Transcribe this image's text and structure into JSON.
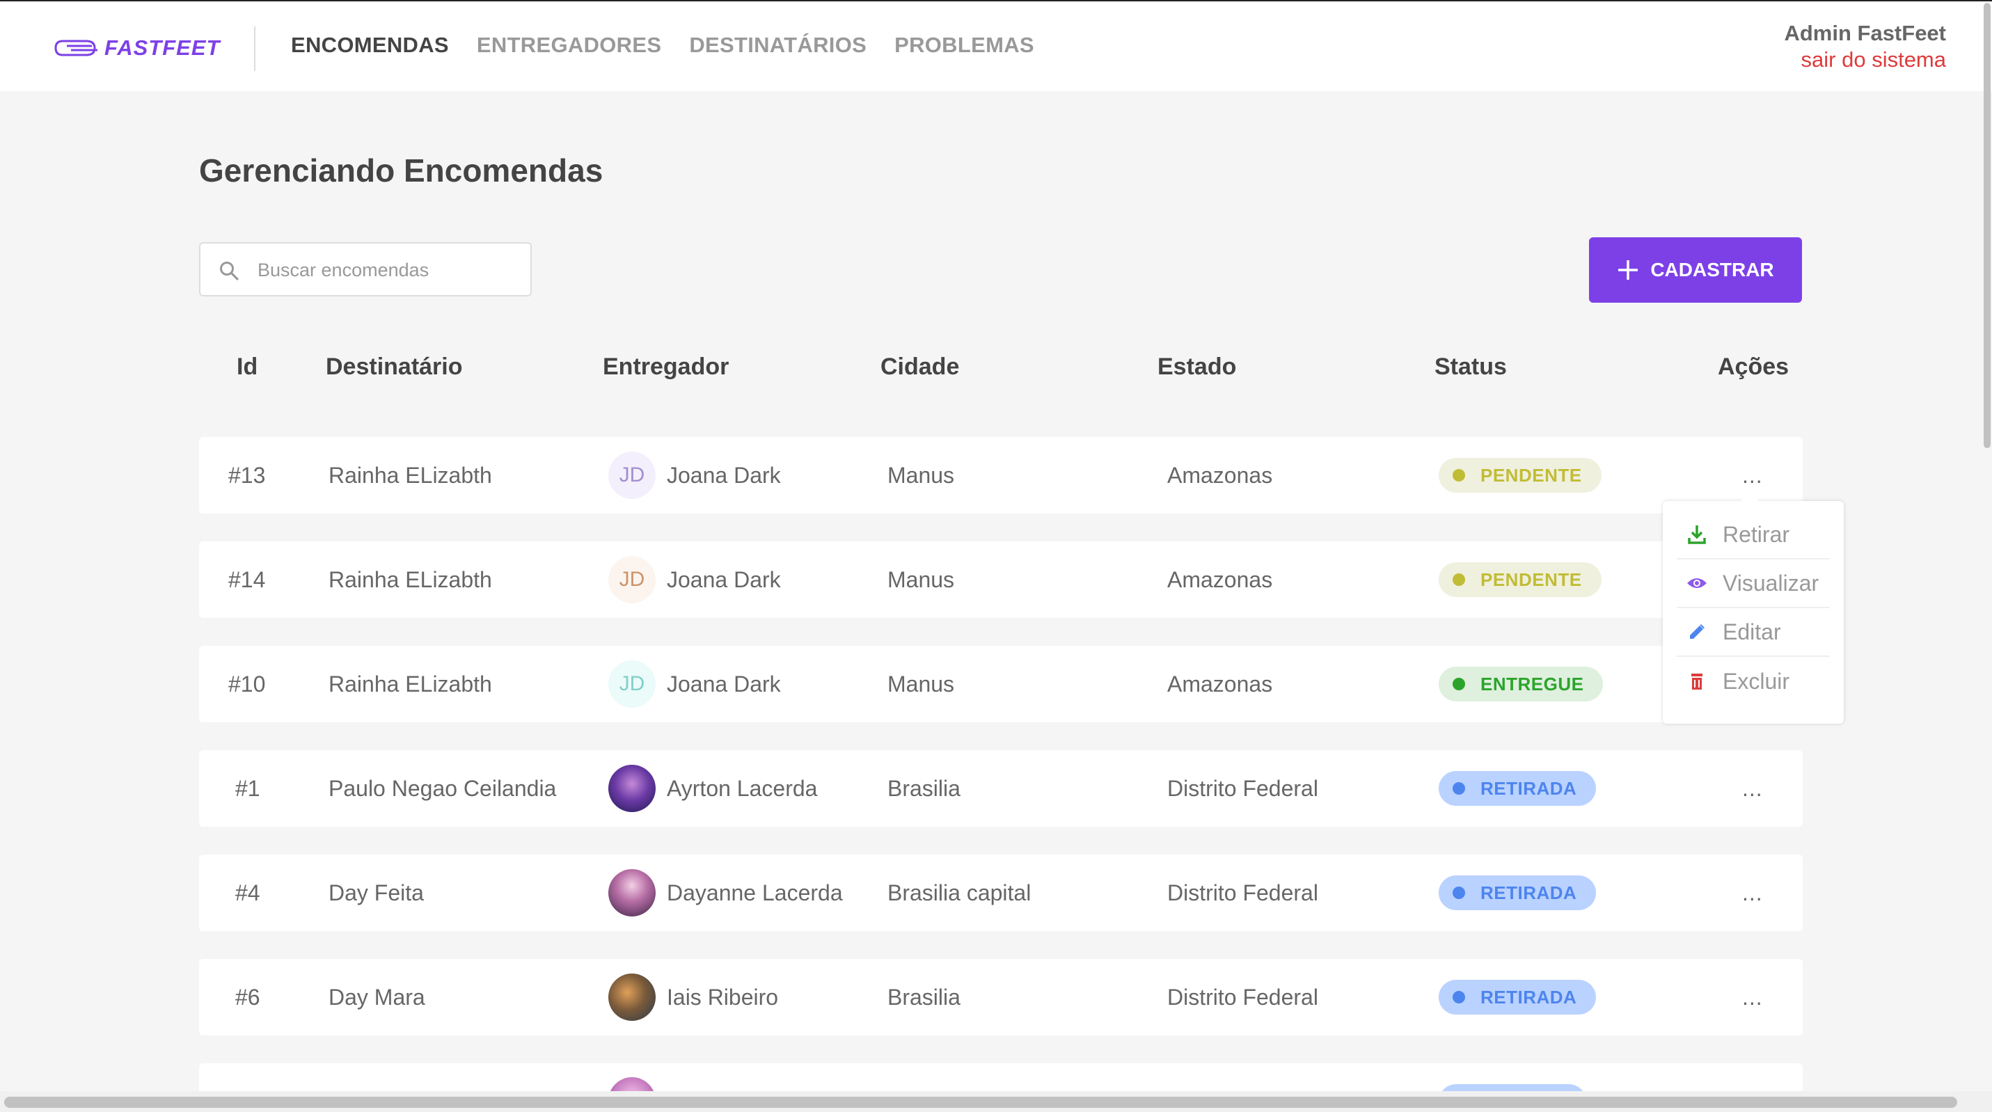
{
  "header": {
    "logo_text": "FASTFEET",
    "nav": [
      {
        "label": "ENCOMENDAS",
        "active": true
      },
      {
        "label": "ENTREGADORES",
        "active": false
      },
      {
        "label": "DESTINATÁRIOS",
        "active": false
      },
      {
        "label": "PROBLEMAS",
        "active": false
      }
    ],
    "user_name": "Admin FastFeet",
    "logout_label": "sair do sistema"
  },
  "page": {
    "title": "Gerenciando Encomendas",
    "search_placeholder": "Buscar encomendas",
    "add_button_label": "CADASTRAR"
  },
  "table": {
    "columns": [
      "Id",
      "Destinatário",
      "Entregador",
      "Cidade",
      "Estado",
      "Status",
      "Ações"
    ],
    "rows": [
      {
        "id": "#13",
        "recipient": "Rainha ELizabth",
        "courier": "Joana Dark",
        "avatar_initials": "JD",
        "city": "Manus",
        "state": "Amazonas",
        "status": "PENDENTE",
        "actions": "..."
      },
      {
        "id": "#14",
        "recipient": "Rainha ELizabth",
        "courier": "Joana Dark",
        "avatar_initials": "JD",
        "city": "Manus",
        "state": "Amazonas",
        "status": "PENDENTE",
        "actions": "..."
      },
      {
        "id": "#10",
        "recipient": "Rainha ELizabth",
        "courier": "Joana Dark",
        "avatar_initials": "JD",
        "city": "Manus",
        "state": "Amazonas",
        "status": "ENTREGUE",
        "actions": "..."
      },
      {
        "id": "#1",
        "recipient": "Paulo Negao Ceilandia",
        "courier": "Ayrton Lacerda",
        "avatar_initials": "",
        "city": "Brasilia",
        "state": "Distrito Federal",
        "status": "RETIRADA",
        "actions": "..."
      },
      {
        "id": "#4",
        "recipient": "Day Feita",
        "courier": "Dayanne Lacerda",
        "avatar_initials": "",
        "city": "Brasilia capital",
        "state": "Distrito Federal",
        "status": "RETIRADA",
        "actions": "..."
      },
      {
        "id": "#6",
        "recipient": "Day Mara",
        "courier": "Iais Ribeiro",
        "avatar_initials": "",
        "city": "Brasilia",
        "state": "Distrito Federal",
        "status": "RETIRADA",
        "actions": "..."
      }
    ]
  },
  "dropdown": {
    "items": [
      {
        "label": "Retirar",
        "icon": "download-icon"
      },
      {
        "label": "Visualizar",
        "icon": "eye-icon"
      },
      {
        "label": "Editar",
        "icon": "pencil-icon"
      },
      {
        "label": "Excluir",
        "icon": "trash-icon"
      }
    ]
  },
  "colors": {
    "brand": "#7d40e7",
    "pendente_bg": "#f0f0df",
    "pendente_fg": "#c1bc35",
    "entregue_bg": "#dff0df",
    "entregue_fg": "#2ca42b",
    "retirada_bg": "#bad2ff",
    "retirada_fg": "#4d85ee",
    "logout": "#de3b3b"
  }
}
